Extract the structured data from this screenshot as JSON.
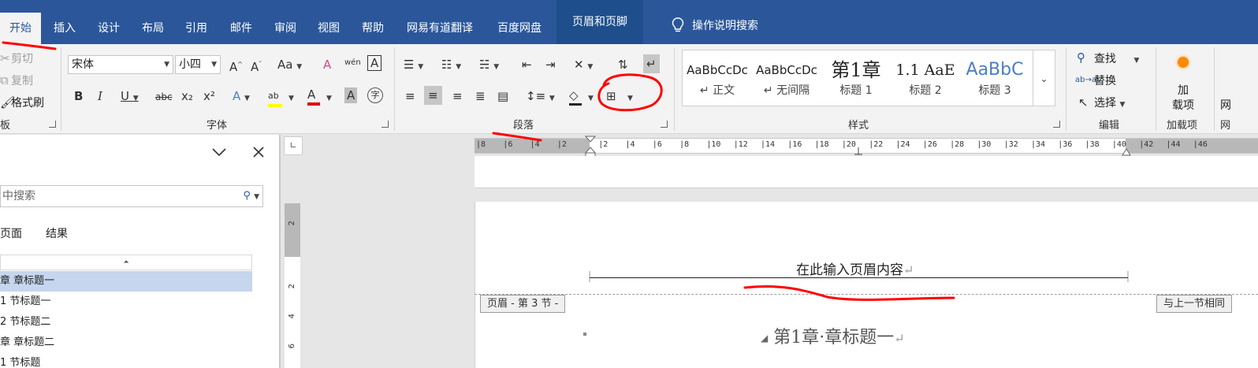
{
  "tabs": {
    "home": "开始",
    "insert": "插入",
    "design": "设计",
    "layout": "布局",
    "references": "引用",
    "mailings": "邮件",
    "review": "审阅",
    "view": "视图",
    "help": "帮助",
    "youdao": "网易有道翻译",
    "baidu": "百度网盘",
    "header_footer": "页眉和页脚",
    "tell_me": "操作说明搜索"
  },
  "clipboard": {
    "cut": "剪切",
    "copy": "复制",
    "format_painter": "格式刷",
    "group_label": "板"
  },
  "font": {
    "name": "宋体",
    "size": "小四",
    "group_label": "字体",
    "change_case": "Aa",
    "bold": "B",
    "italic": "I",
    "underline": "U",
    "strikethrough": "abc",
    "subscript": "x₂",
    "superscript": "x²",
    "phonetic": "wén"
  },
  "paragraph": {
    "group_label": "段落"
  },
  "styles": {
    "group_label": "样式",
    "items": [
      {
        "preview": "AaBbCcDc",
        "name": "↵ 正文"
      },
      {
        "preview": "AaBbCcDc",
        "name": "↵ 无间隔"
      },
      {
        "preview": "第1章",
        "name": "标题 1"
      },
      {
        "preview": "1.1 AaE",
        "name": "标题 2"
      },
      {
        "preview": "AaBbC",
        "name": "标题 3"
      }
    ]
  },
  "editing": {
    "group_label": "编辑",
    "find": "查找",
    "replace": "替换",
    "select": "选择"
  },
  "addins": {
    "group_label": "加载项",
    "button_line1": "加",
    "button_line2": "载项",
    "cutoff": "网"
  },
  "navigation": {
    "search_placeholder": "中搜索",
    "tab_pages": "页面",
    "tab_results": "结果",
    "headings": [
      "章 章标题一",
      "1 节标题一",
      "2 节标题二",
      "章 章标题二",
      "1 节标题"
    ]
  },
  "ruler": {
    "ticks": [
      "8",
      "6",
      "4",
      "2",
      "2",
      "4",
      "6",
      "8",
      "10",
      "12",
      "14",
      "16",
      "18",
      "20",
      "22",
      "24",
      "26",
      "28",
      "30",
      "32",
      "34",
      "36",
      "38",
      "40",
      "42",
      "44",
      "46"
    ],
    "vticks": [
      "2",
      "2",
      "4",
      "6"
    ]
  },
  "document": {
    "header_text": "在此输入页眉内容",
    "header_tag": "页眉 - 第 3 节 -",
    "link_tag": "与上一节相同",
    "heading": "第1章·章标题一"
  },
  "colors": {
    "tab_blue": "#2b579a",
    "ink_red": "#ff0000"
  }
}
